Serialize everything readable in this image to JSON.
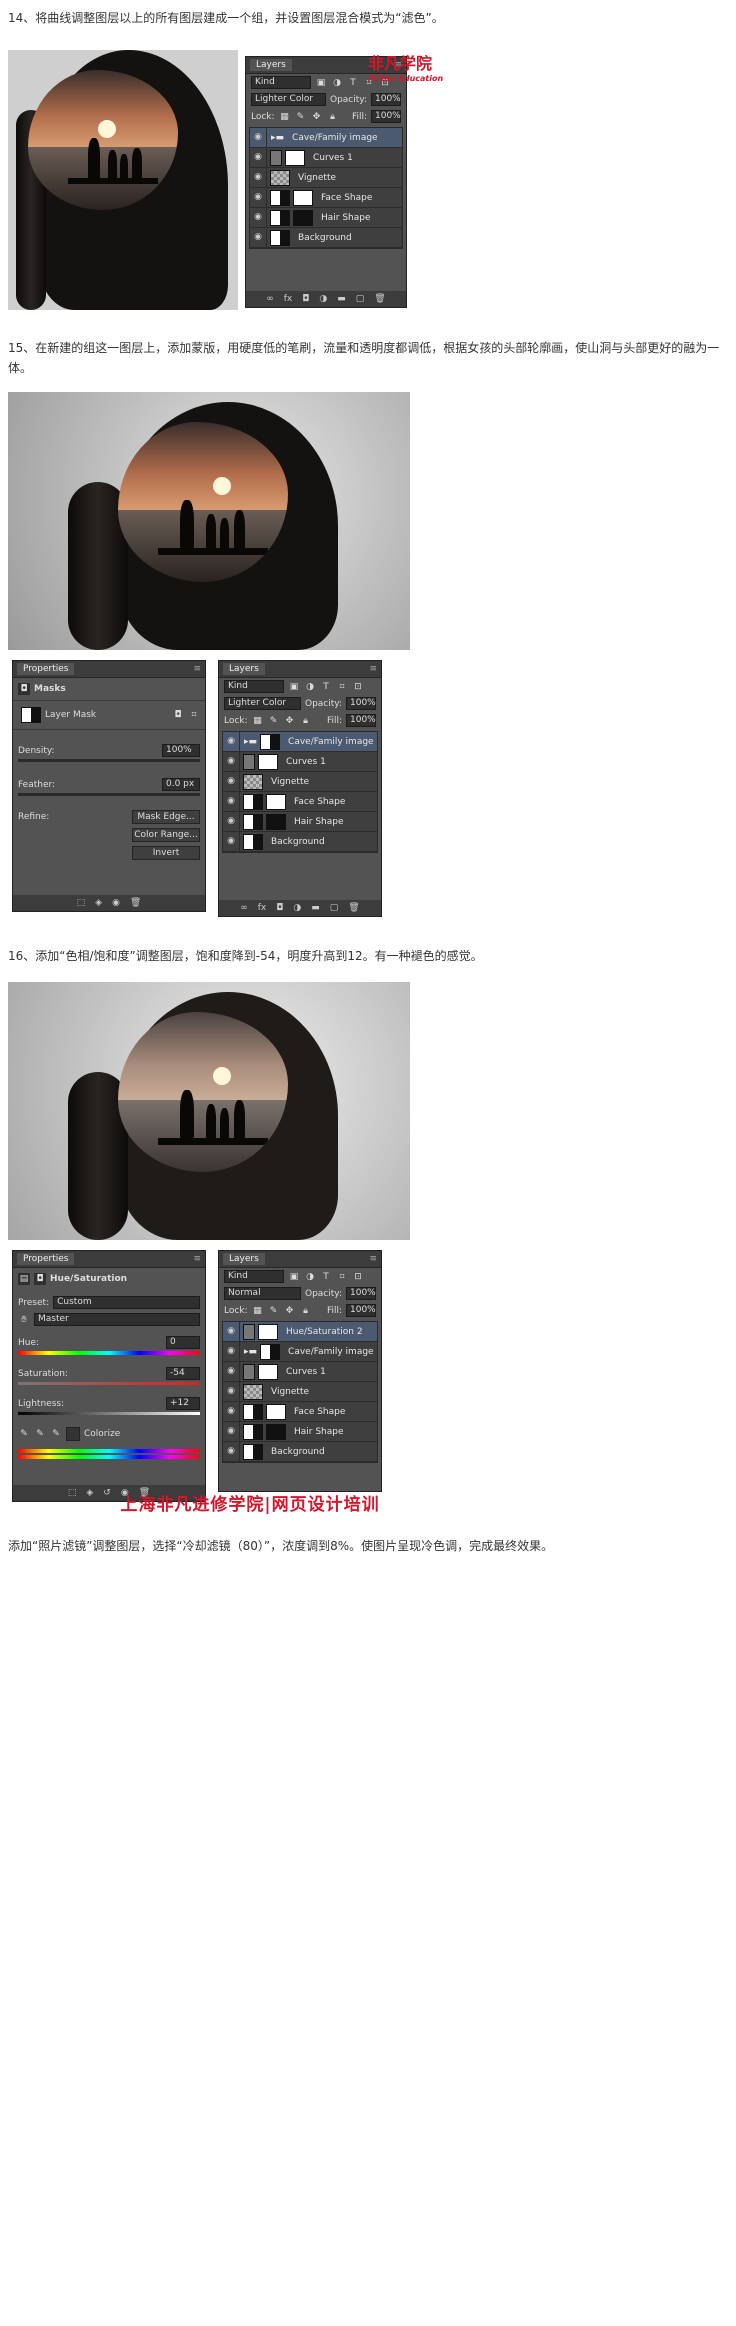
{
  "steps": {
    "s14": "14、将曲线调整图层以上的所有图层建成一个组，并设置图层混合模式为“滤色”。",
    "s15": "15、在新建的组这一图层上，添加蒙版，用硬度低的笔刷，流量和透明度都调低，根据女孩的头部轮廓画，使山洞与头部更好的融为一体。",
    "s16": "16、添加“色相/饱和度”调整图层，饱和度降到-54，明度升高到12。有一种褪色的感觉。",
    "final": "添加“照片滤镜”调整图层，选择“冷却滤镜（80）”，浓度调到8%。使图片呈现冷色调，完成最终效果。"
  },
  "logo": {
    "main": "非凡学院",
    "sub": "Feifan Education"
  },
  "watermark": "上海非凡进修学院|网页设计培训",
  "layers1": {
    "tab": "Layers",
    "kind": "Kind",
    "blend": "Lighter Color",
    "opacity_label": "Opacity:",
    "opacity": "100%",
    "lock_label": "Lock:",
    "fill_label": "Fill:",
    "fill": "100%",
    "items": [
      "Cave/Family image",
      "Curves 1",
      "Vignette",
      "Face Shape",
      "Hair Shape",
      "Background"
    ]
  },
  "props2": {
    "tab": "Properties",
    "title": "Masks",
    "mask_label": "Layer Mask",
    "density_label": "Density:",
    "density": "100%",
    "feather_label": "Feather:",
    "feather": "0.0 px",
    "refine_label": "Refine:",
    "btn_edge": "Mask Edge...",
    "btn_color": "Color Range...",
    "btn_invert": "Invert"
  },
  "layers2": {
    "tab": "Layers",
    "kind": "Kind",
    "blend": "Lighter Color",
    "opacity_label": "Opacity:",
    "opacity": "100%",
    "lock_label": "Lock:",
    "fill_label": "Fill:",
    "fill": "100%",
    "items": [
      "Cave/Family image",
      "Curves 1",
      "Vignette",
      "Face Shape",
      "Hair Shape",
      "Background"
    ]
  },
  "props3": {
    "tab": "Properties",
    "title": "Hue/Saturation",
    "preset_label": "Preset:",
    "preset": "Custom",
    "channel": "Master",
    "hue_label": "Hue:",
    "hue": "0",
    "sat_label": "Saturation:",
    "sat": "-54",
    "light_label": "Lightness:",
    "light": "+12",
    "colorize": "Colorize"
  },
  "layers3": {
    "tab": "Layers",
    "kind": "Kind",
    "blend": "Normal",
    "opacity_label": "Opacity:",
    "opacity": "100%",
    "lock_label": "Lock:",
    "fill_label": "Fill:",
    "fill": "100%",
    "items": [
      "Hue/Saturation 2",
      "Cave/Family image",
      "Curves 1",
      "Vignette",
      "Face Shape",
      "Hair Shape",
      "Background"
    ]
  }
}
